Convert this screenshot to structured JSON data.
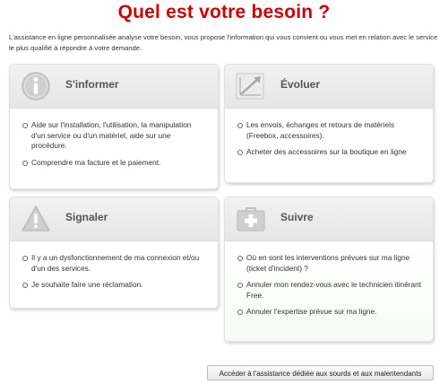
{
  "page": {
    "title": "Quel est votre besoin ?",
    "intro": "L'assistance en ligne personnalisée analyse votre besoin, vous propose l'information qui vous convient ou vous met en relation avec le service le plus qualifié à répondre à votre demande."
  },
  "cards": {
    "informer": {
      "title": "S'informer",
      "icon": "info-icon",
      "items": [
        "Aide sur l'installation, l'utilisation, la manipulation d'un service ou d'un matériel, aide sur une procédure.",
        "Comprendre ma facture et le paiement."
      ]
    },
    "evoluer": {
      "title": "Évoluer",
      "icon": "growth-chart-icon",
      "items": [
        "Les envois, échanges et retours de matériels (Freebox, accessoires).",
        "Acheter des accessoires sur la boutique en ligne"
      ]
    },
    "signaler": {
      "title": "Signaler",
      "icon": "warning-icon",
      "items": [
        "Il y a un dysfonctionnement de ma connexion et/ou d'un des services.",
        "Je souhaite faire une réclamation."
      ]
    },
    "suivre": {
      "title": "Suivre",
      "icon": "first-aid-kit-icon",
      "items": [
        "Où en sont les interventions prévues sur ma ligne (ticket d'incident) ?",
        "Annuler mon rendez-vous avec le technicien itinérant Free.",
        "Annuler l'expertise prévue sur ma ligne."
      ]
    }
  },
  "footer": {
    "button_label": "Accéder à l'assistance dédiée aux sourds et aux malentendants"
  },
  "colors": {
    "title": "#cc0000",
    "card_header": "#e9e9e9",
    "suivre_body": "#f3faf3"
  }
}
